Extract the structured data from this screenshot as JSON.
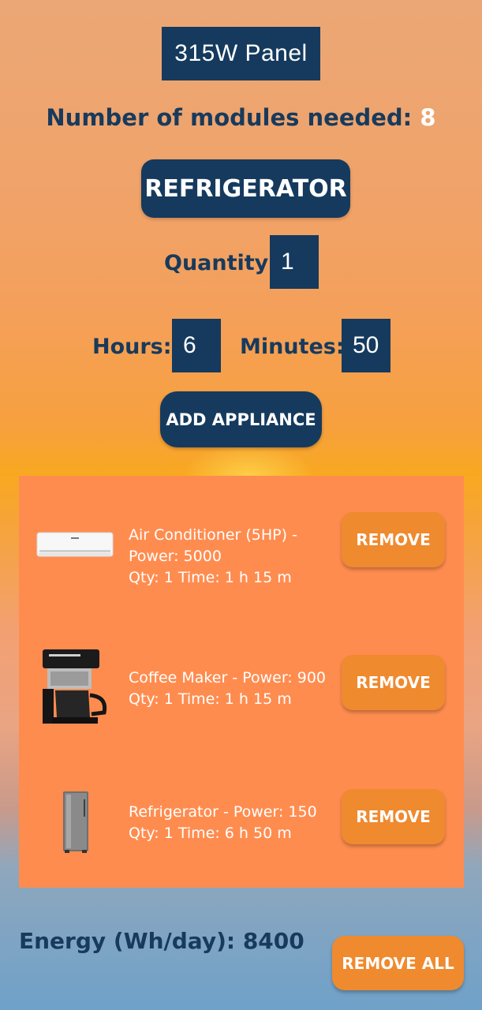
{
  "panel": {
    "type_label": "315W Panel"
  },
  "modules": {
    "label": "Number of modules needed:",
    "value": "8"
  },
  "appliance_selector": {
    "selected": "REFRIGERATOR"
  },
  "quantity": {
    "label": "Quantity:",
    "value": "1"
  },
  "time": {
    "hours_label": "Hours:",
    "hours_value": "6",
    "minutes_label": "Minutes:",
    "minutes_value": "50"
  },
  "add_button": {
    "label": "ADD APPLIANCE"
  },
  "appliances": [
    {
      "icon": "air-conditioner-icon",
      "line1": "Air Conditioner (5HP) -",
      "line2": "Power: 5000",
      "line3": "Qty: 1 Time: 1 h 15 m",
      "remove_label": "REMOVE"
    },
    {
      "icon": "coffee-maker-icon",
      "line1": "Coffee Maker - Power: 900",
      "line2": "Qty: 1 Time: 1 h 15 m",
      "remove_label": "REMOVE"
    },
    {
      "icon": "refrigerator-icon",
      "line1": "Refrigerator - Power: 150",
      "line2": "Qty: 1 Time: 6 h 50 m",
      "remove_label": "REMOVE"
    }
  ],
  "energy": {
    "label": "Energy (Wh/day):",
    "value": "8400"
  },
  "remove_all_button": {
    "label": "REMOVE ALL"
  },
  "colors": {
    "navy": "#153a5e",
    "orange_button": "#ef8a2f",
    "list_background": "#ff8c4f"
  }
}
